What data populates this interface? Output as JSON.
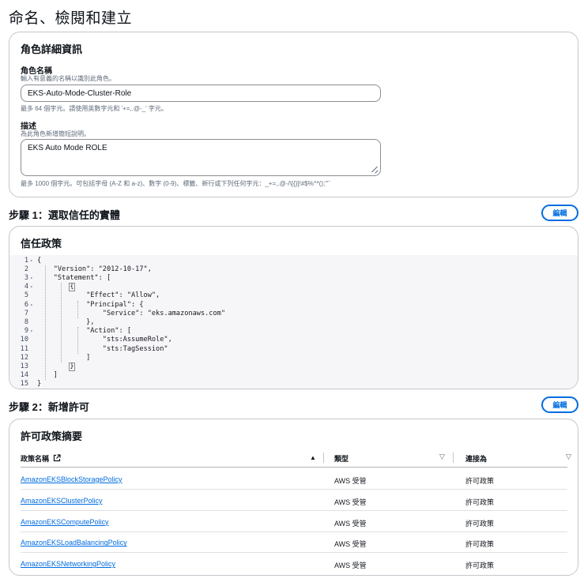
{
  "page": {
    "title": "命名、檢閱和建立"
  },
  "role_details": {
    "heading": "角色詳細資訊",
    "name_label": "角色名稱",
    "name_description": "輸入有意義的名稱以識別此角色。",
    "name_value": "EKS-Auto-Mode-Cluster-Role",
    "name_constraint": "最多 64 個字元。請使用英數字元和 '+=,.@-_' 字元。",
    "desc_label": "描述",
    "desc_description": "為此角色新增簡短說明。",
    "desc_value": "EKS Auto Mode ROLE",
    "desc_constraint": "最多 1000 個字元。可包括字母 (A-Z 和 a-z)、數字 (0-9)、標籤、新行或下列任何字元：_+=,.@-/\\[{}]!#$%^*();'\"`"
  },
  "step1": {
    "heading": "步驟 1：選取信任的實體",
    "edit_label": "編輯",
    "card_heading": "信任政策",
    "code_lines": [
      {
        "n": "1",
        "fold": "▾",
        "text": "{"
      },
      {
        "n": "2",
        "fold": "",
        "text": "    \"Version\": \"2012-10-17\","
      },
      {
        "n": "3",
        "fold": "▾",
        "text": "    \"Statement\": ["
      },
      {
        "n": "4",
        "fold": "▾",
        "text": "        {"
      },
      {
        "n": "5",
        "fold": "",
        "text": "            \"Effect\": \"Allow\","
      },
      {
        "n": "6",
        "fold": "▾",
        "text": "            \"Principal\": {"
      },
      {
        "n": "7",
        "fold": "",
        "text": "                \"Service\": \"eks.amazonaws.com\""
      },
      {
        "n": "8",
        "fold": "",
        "text": "            },"
      },
      {
        "n": "9",
        "fold": "▾",
        "text": "            \"Action\": ["
      },
      {
        "n": "10",
        "fold": "",
        "text": "                \"sts:AssumeRole\","
      },
      {
        "n": "11",
        "fold": "",
        "text": "                \"sts:TagSession\""
      },
      {
        "n": "12",
        "fold": "",
        "text": "            ]"
      },
      {
        "n": "13",
        "fold": "",
        "text": "        }"
      },
      {
        "n": "14",
        "fold": "",
        "text": "    ]"
      },
      {
        "n": "15",
        "fold": "",
        "text": "}"
      }
    ]
  },
  "step2": {
    "heading": "步驟 2：新增許可",
    "edit_label": "編輯",
    "card_heading": "許可政策摘要",
    "columns": {
      "name": "政策名稱",
      "type": "類型",
      "attached_as": "連接為"
    },
    "rows": [
      {
        "name": "AmazonEKSBlockStoragePolicy",
        "type": "AWS 受管",
        "attached_as": "許可政策"
      },
      {
        "name": "AmazonEKSClusterPolicy",
        "type": "AWS 受管",
        "attached_as": "許可政策"
      },
      {
        "name": "AmazonEKSComputePolicy",
        "type": "AWS 受管",
        "attached_as": "許可政策"
      },
      {
        "name": "AmazonEKSLoadBalancingPolicy",
        "type": "AWS 受管",
        "attached_as": "許可政策"
      },
      {
        "name": "AmazonEKSNetworkingPolicy",
        "type": "AWS 受管",
        "attached_as": "許可政策"
      }
    ]
  },
  "icons": {
    "external_link": "external-link-icon",
    "sort_ascending": "caret-up-icon",
    "sort_inactive": "caret-down-icon",
    "fold": "fold-arrow-icon"
  },
  "colors": {
    "accent": "#006ce0",
    "border": "#c6c6cd",
    "code_bg": "#f6f6f9"
  }
}
